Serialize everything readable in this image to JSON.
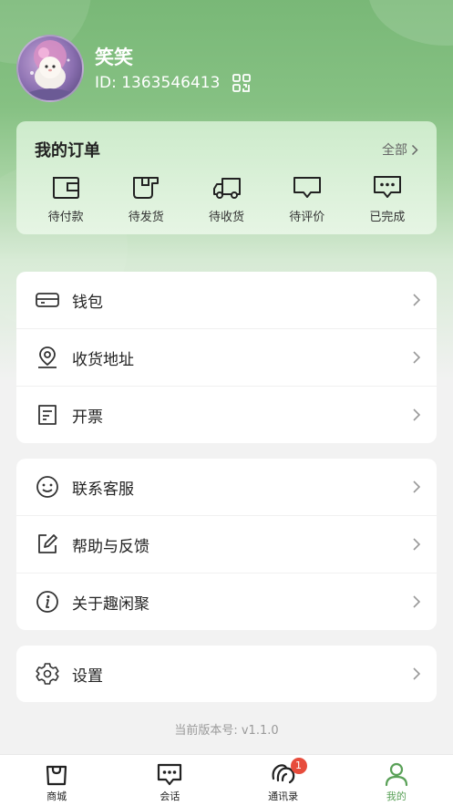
{
  "user": {
    "nickname": "笑笑",
    "id_text": "ID: 1363546413"
  },
  "orders": {
    "title": "我的订单",
    "all_label": "全部",
    "items": [
      {
        "label": "待付款",
        "icon": "wallet-icon"
      },
      {
        "label": "待发货",
        "icon": "package-icon"
      },
      {
        "label": "待收货",
        "icon": "truck-icon"
      },
      {
        "label": "待评价",
        "icon": "comment-icon"
      },
      {
        "label": "已完成",
        "icon": "chat-dots-icon"
      }
    ]
  },
  "menu_groups": [
    [
      {
        "label": "钱包",
        "icon": "card-icon"
      },
      {
        "label": "收货地址",
        "icon": "location-icon"
      },
      {
        "label": "开票",
        "icon": "invoice-icon"
      }
    ],
    [
      {
        "label": "联系客服",
        "icon": "smile-icon"
      },
      {
        "label": "帮助与反馈",
        "icon": "edit-icon"
      },
      {
        "label": "关于趣闲聚",
        "icon": "info-icon"
      }
    ],
    [
      {
        "label": "设置",
        "icon": "gear-icon"
      }
    ]
  ],
  "version_text": "当前版本号: v1.1.0",
  "tabbar": {
    "tabs": [
      {
        "label": "商城",
        "icon": "shop-bag-icon",
        "active": false
      },
      {
        "label": "会话",
        "icon": "chat-icon",
        "active": false
      },
      {
        "label": "通讯录",
        "icon": "contacts-icon",
        "active": false,
        "badge": "1"
      },
      {
        "label": "我的",
        "icon": "person-icon",
        "active": true
      }
    ]
  },
  "colors": {
    "brand_green": "#5aa158",
    "header_green": "#79b877",
    "badge_red": "#e74c3c"
  }
}
